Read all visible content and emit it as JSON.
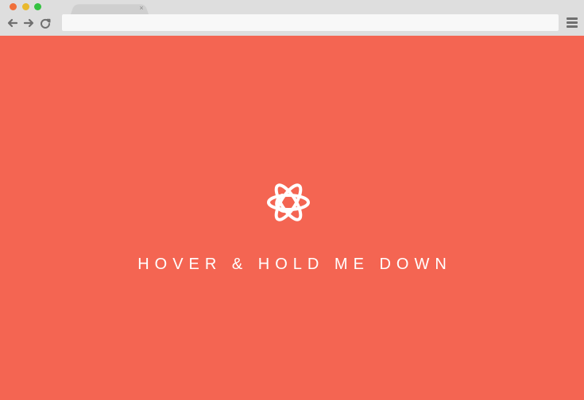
{
  "browser": {
    "tab": {
      "close_symbol": "×"
    },
    "toolbar": {
      "back_icon": "arrow-left",
      "forward_icon": "arrow-right",
      "reload_icon": "reload",
      "menu_icon": "hamburger-menu"
    },
    "window_controls": [
      "close",
      "minimize",
      "maximize"
    ]
  },
  "page": {
    "icon": "atom-icon",
    "text": "HOVER & HOLD ME DOWN"
  },
  "colors": {
    "background": "#f46552",
    "chrome": "#dedede",
    "address_bar": "#f8f8f8",
    "text": "#ffffff",
    "window_close": "#f0703a",
    "window_minimize": "#e9b92d",
    "window_maximize": "#34c241"
  }
}
